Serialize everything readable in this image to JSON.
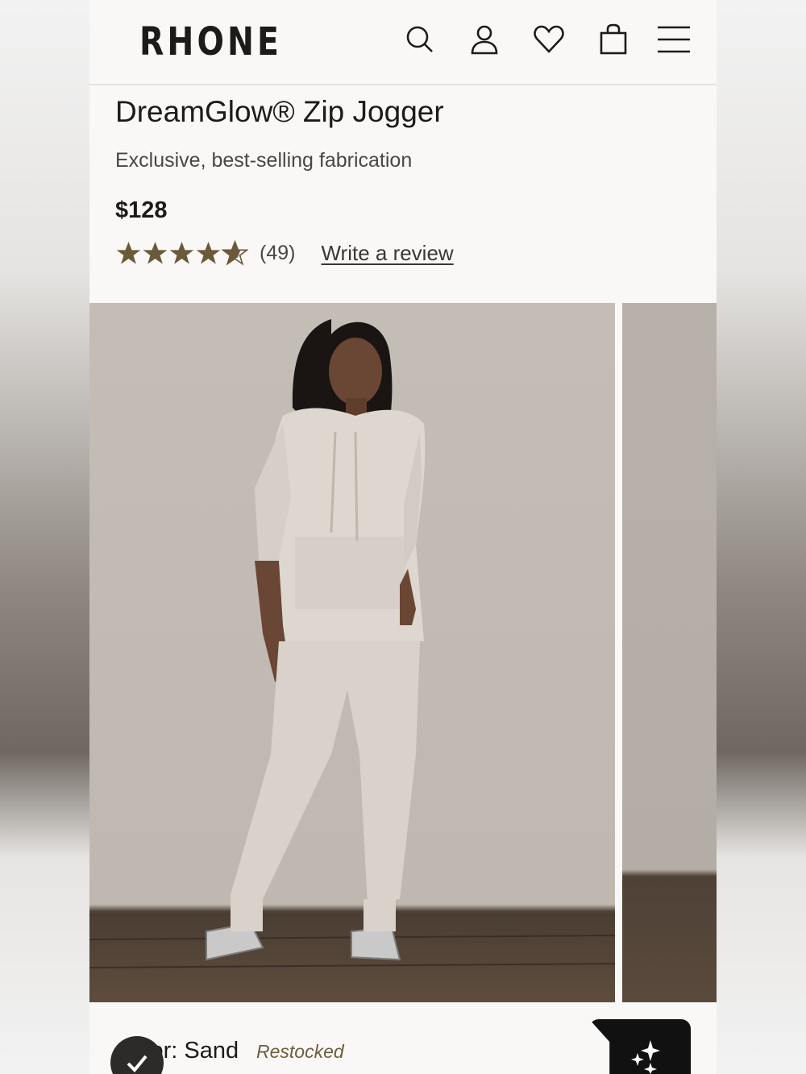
{
  "header": {
    "brand": "RHONE",
    "icons": [
      "search-icon",
      "account-icon",
      "wishlist-heart-icon",
      "shopping-bag-icon",
      "menu-icon"
    ]
  },
  "product": {
    "title": "DreamGlow® Zip Jogger",
    "subtitle": "Exclusive, best-selling fabrication",
    "price": "$128",
    "rating": {
      "value": 4.5,
      "max": 5,
      "count_text": "(49)",
      "star_color": "#6b5a3a"
    },
    "review_link": "Write a review"
  },
  "gallery": {
    "images": [
      "model-front-photo",
      "model-next-photo"
    ]
  },
  "options": {
    "color_label": "Color: Sand",
    "color_status": "Restocked"
  },
  "colors": {
    "accent": "#6b5a3a",
    "text": "#1d1b19",
    "background": "#f9f8f6"
  }
}
